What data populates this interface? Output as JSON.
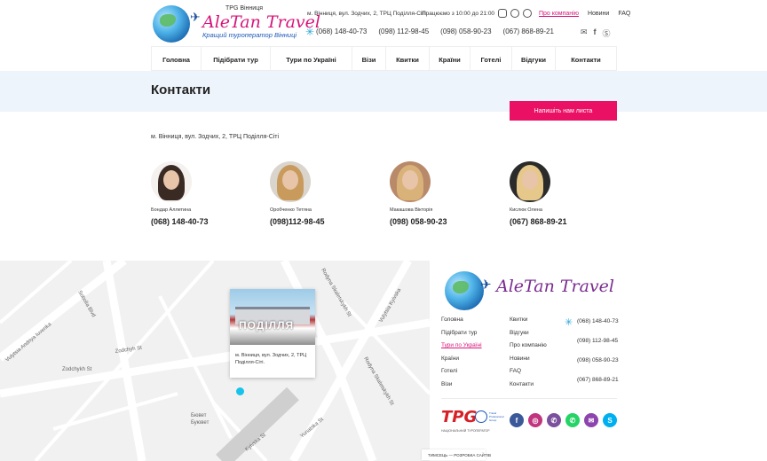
{
  "header": {
    "logo": {
      "top_text": "TPG Вінниця",
      "title": "AleTan Travel",
      "tagline": "Кращий туроператор Вінниці"
    },
    "address": "м. Вінниця, вул. Зодчих, 2, ТРЦ Поділля-Сіті",
    "hours": "Працюємо з 10:00 до 21:00",
    "links": [
      "Про компанію",
      "Новини",
      "FAQ"
    ],
    "phones": [
      "(068) 148-40-73",
      "(098) 112-98-45",
      "(098) 058-90-23",
      "(067) 868-89-21"
    ],
    "social_icons": [
      "instagram-icon",
      "viber-icon",
      "whatsapp-icon"
    ],
    "contact_icons": [
      "email-icon",
      "facebook-icon",
      "skype-icon"
    ]
  },
  "nav": [
    "Головна",
    "Підібрати тур",
    "Тури по Україні",
    "Візи",
    "Квитки",
    "Країни",
    "Готелі",
    "Відгуки",
    "Контакти"
  ],
  "page": {
    "title": "Контакти",
    "write_button": "Напишіть нам листа",
    "address": "м. Вінниця, вул. Зодчих, 2, ТРЦ Поділля-Сіті"
  },
  "managers": [
    {
      "name": "Бондар Аллетина",
      "phone": "(068) 148-40-73"
    },
    {
      "name": "Оробченко Тетяна",
      "phone": "(098)112-98-45"
    },
    {
      "name": "Макашова Вікторія",
      "phone": "(098) 058-90-23"
    },
    {
      "name": "Кислюк Олена",
      "phone": "(067) 868-89-21"
    }
  ],
  "map": {
    "street_labels": [
      "Zodchykh St",
      "Zodchyh St",
      "Sobolia Blvd",
      "Vulytsia Andriya Iuvenka",
      "Vulytsia Kyivska",
      "Rodyna Skaletskykh St",
      "Rodyna Skaletskykh St",
      "Kyivska St",
      "Yunatska St",
      "Бювет",
      "Буювет"
    ],
    "popup": {
      "image_caption": "ПОДІЛЛЯ",
      "text": "м. Вінниця, вул. Зодчих, 2, ТРЦ Поділля-Сіті."
    }
  },
  "footer": {
    "logo_title": "AleTan Travel",
    "col1": [
      "Головна",
      "Підібрати тур",
      "Тури по Україні",
      "Країни",
      "Готелі",
      "Візи"
    ],
    "col2": [
      "Квитки",
      "Відгуки",
      "Про компанію",
      "Новини",
      "FAQ",
      "Контакти"
    ],
    "phones": [
      "(068) 148-40-73",
      "(098) 112-98-45",
      "(098) 058-90-23",
      "(067) 868-89-21"
    ],
    "tpg": {
      "word": "TPG",
      "small_text": "Travel Professional Group",
      "caption": "НАЦІОНАЛЬНИЙ ТУРОПЕРАТОР"
    },
    "socials": [
      {
        "icon": "facebook-icon",
        "glyph": "f",
        "color": "#3b5998"
      },
      {
        "icon": "instagram-icon",
        "glyph": "◎",
        "color": "#c1357f"
      },
      {
        "icon": "viber-icon",
        "glyph": "✆",
        "color": "#7b519d"
      },
      {
        "icon": "whatsapp-icon",
        "glyph": "✆",
        "color": "#25d366"
      },
      {
        "icon": "email-icon",
        "glyph": "✉",
        "color": "#8e44ad"
      },
      {
        "icon": "skype-icon",
        "glyph": "S",
        "color": "#00aff0"
      }
    ],
    "badge": "ТИМСЕЦЬ — РОЗРОБКА САЙТІВ"
  },
  "colors": {
    "accent_pink": "#ea1064",
    "brand_magenta": "#d7157a",
    "brand_blue": "#1a57b8",
    "band_bg": "#eef4fb",
    "map_pin": "#18c3ea"
  }
}
